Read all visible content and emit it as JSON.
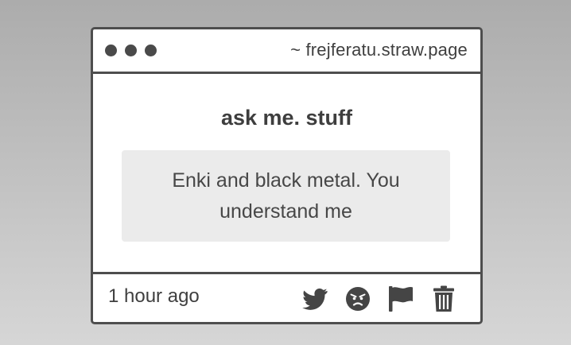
{
  "window": {
    "url": "~ frejferatu.straw.page"
  },
  "card": {
    "title": "ask me. stuff",
    "message": "Enki and black metal. You understand me",
    "timestamp": "1 hour ago"
  },
  "actions": [
    {
      "icon": "twitter-icon"
    },
    {
      "icon": "angry-face-icon"
    },
    {
      "icon": "flag-icon"
    },
    {
      "icon": "trash-icon"
    }
  ],
  "colors": {
    "border": "#4e4e4e",
    "icon": "#454545",
    "message_bg": "#ebebeb",
    "text": "#3f3f3f"
  }
}
